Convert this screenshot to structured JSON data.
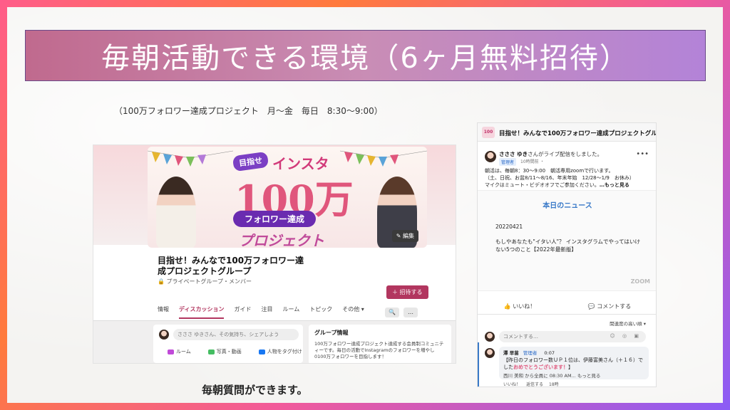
{
  "slide": {
    "title": "毎朝活動できる環境（6ヶ月無料招待）",
    "subtitle": "（100万フォロワー達成プロジェクト　月〜金　毎日　8:30〜9:00）",
    "caption": "毎朝質問ができます。"
  },
  "group_page": {
    "banner": {
      "tag": "目指せ",
      "insta": "インスタ",
      "big": "100万",
      "ribbon": "フォロワー達成",
      "project": "プロジェクト",
      "edit_label": "✎ 編集"
    },
    "name": "目指せ！みんなで100万フォロワー達成プロジェクトグループ",
    "meta": "🔒 プライベートグループ・メンバー",
    "invite_label": "＋ 招待する",
    "tabs": [
      "情報",
      "ディスカッション",
      "ガイド",
      "注目",
      "ルーム",
      "トピック",
      "その他 ▾"
    ],
    "search_icon": "🔍",
    "more_icon": "…",
    "composer_placeholder": "さささ ゆきさん、その気持ち、シェアしよう",
    "composer_actions": [
      "ルーム",
      "写真・動画",
      "人物をタグ付け"
    ],
    "info_title": "グループ情報",
    "info_body": "100万フォロワー達成プロジェクト達成する会員制コミュニティーです。毎日の活動でInstagramのフォロワーを増やし0100万フォロワーを目指します！"
  },
  "post_view": {
    "logo": "100",
    "header_title": "目指せ！みんなで100万フォロワー達成プロジェクトグループ",
    "author_name": "さささ ゆき",
    "author_action": "さんがライブ配信をしました。",
    "role": "管理者",
    "time": "10時間前 ・",
    "text_line1": "朝活は、毎朝8：30〜9:00　朝活専用zoomで行います。",
    "text_line2": "（土、日祝、お盆8/11〜8/16、年末年始　12/28〜1/9　お休み）",
    "text_line3": "マイクはミュート・ビデオオフでご参加ください。",
    "see_more": "…もっと見る",
    "news_title": "本日のニュース",
    "news_date": "20220421",
    "news_body": "もしやあなたも\"イタい人\"？ インスタグラムでやってはいけない5つのこと【2022年最新版】",
    "zoom_mark": "ZOOM",
    "like_label": "👍 いいね！",
    "comment_label": "💬 コメントする",
    "sort_label": "関連度の高い順 ▾",
    "comment_placeholder": "コメントする…",
    "comment_tools": "☺ ◎ ▣",
    "comment_author": "澤 早苗",
    "comment_role": "管理者",
    "comment_time": "0:07",
    "comment_text": "【昨日のフォロワー数ＵＰ１位は、伊藤富美さん（＋１６）でした",
    "comment_congrats": "おめでとうございます！",
    "comment_tail": "】",
    "comment_foot": "西川 美和 から全員に 08:30 AM... もっと見る",
    "comment_actions": [
      "いいね！",
      "返信する",
      "18時"
    ]
  }
}
